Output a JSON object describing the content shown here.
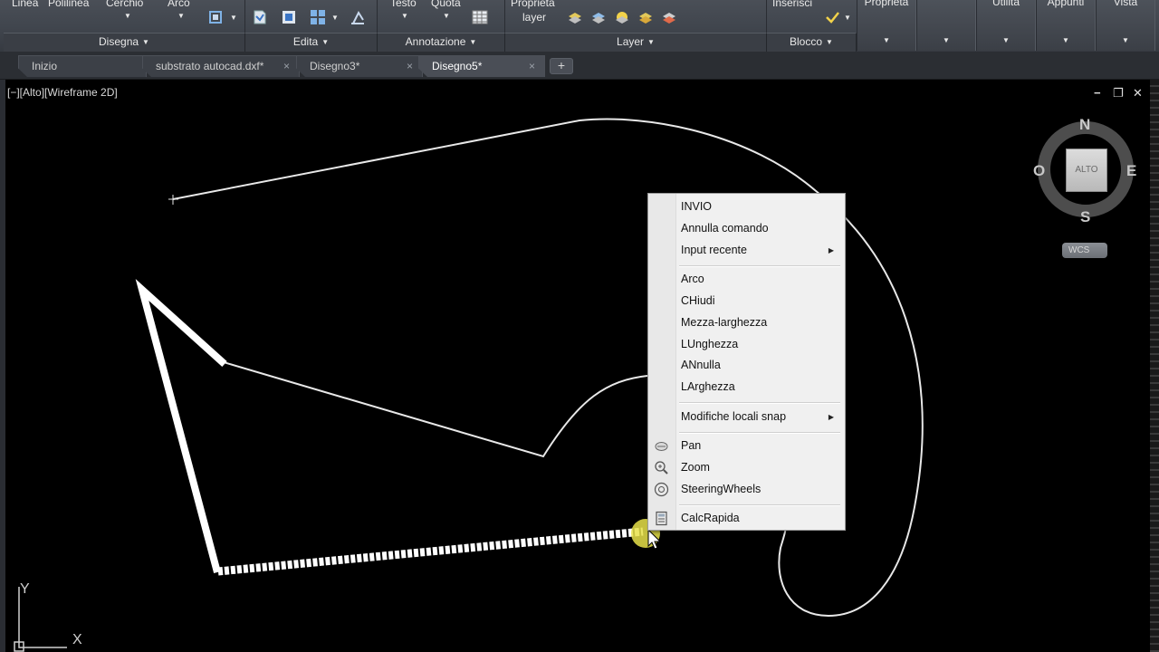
{
  "ribbon": {
    "top_labels": [
      "Linea",
      "Polilinea",
      "Cerchio",
      "Arco",
      "Testo",
      "Quota",
      "Proprietà",
      "layer",
      "Inserisci"
    ],
    "panels": [
      "Disegna",
      "Edita",
      "Annotazione",
      "Layer",
      "Blocco"
    ],
    "right_buttons": [
      "Proprietà",
      "",
      "",
      "Utilità",
      "Appunti",
      "Vista"
    ]
  },
  "tabs": [
    {
      "label": "Inizio",
      "closable": false,
      "active": false
    },
    {
      "label": "substrato autocad.dxf*",
      "closable": true,
      "active": false
    },
    {
      "label": "Disegno3*",
      "closable": true,
      "active": false
    },
    {
      "label": "Disegno5*",
      "closable": true,
      "active": true
    }
  ],
  "tab_add_glyph": "+",
  "tab_close_glyph": "×",
  "viewport": {
    "label": "[−][Alto][Wireframe 2D]",
    "controls": [
      "−",
      "❐",
      "✕"
    ]
  },
  "viewcube": {
    "north": "N",
    "south": "S",
    "east": "E",
    "west": "O",
    "face": "ALTO",
    "wcs": "WCS"
  },
  "context_menu": {
    "items": [
      {
        "label": "INVIO",
        "submenu": false,
        "icon": ""
      },
      {
        "label": "Annulla comando",
        "submenu": false,
        "icon": ""
      },
      {
        "label": "Input recente",
        "submenu": true,
        "icon": ""
      },
      {
        "label": "Arco",
        "submenu": false,
        "icon": ""
      },
      {
        "label": "CHiudi",
        "submenu": false,
        "icon": ""
      },
      {
        "label": "Mezza-larghezza",
        "submenu": false,
        "icon": ""
      },
      {
        "label": "LUnghezza",
        "submenu": false,
        "icon": ""
      },
      {
        "label": "ANnulla",
        "submenu": false,
        "icon": ""
      },
      {
        "label": "LArghezza",
        "submenu": false,
        "icon": ""
      },
      {
        "label": "Modifiche locali snap",
        "submenu": true,
        "icon": ""
      },
      {
        "label": "Pan",
        "submenu": false,
        "icon": "pan-icon"
      },
      {
        "label": "Zoom",
        "submenu": false,
        "icon": "zoom-icon"
      },
      {
        "label": "SteeringWheels",
        "submenu": false,
        "icon": "steeringwheels-icon"
      },
      {
        "label": "CalcRapida",
        "submenu": false,
        "icon": "calculator-icon"
      }
    ],
    "submenu_glyph": "▶"
  },
  "ucs": {
    "x": "X",
    "y": "Y"
  },
  "colors": {
    "ribbon": "#3f444c",
    "canvas": "#000000",
    "menu_bg": "#f0f0f0",
    "cursor_highlight": "#e8e24a"
  }
}
